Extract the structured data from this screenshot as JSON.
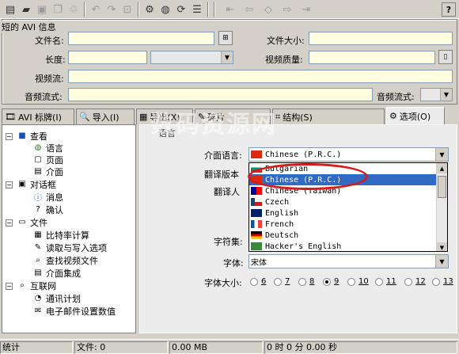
{
  "toolbar": {
    "icons": [
      "new-file-icon",
      "open-folder-icon",
      "save-icon",
      "copy-icon",
      "recycle-icon",
      "undo-icon",
      "redo-icon",
      "config-icon",
      "web-icon",
      "refresh-icon",
      "list-icon",
      "first-icon",
      "prev-icon",
      "diamond-icon",
      "next-icon",
      "last-icon"
    ],
    "help_label": "?"
  },
  "info_group": {
    "title": "短的 AVI 信息",
    "file_name_label": "文件名:",
    "file_name_value": "",
    "file_size_label": "文件大小:",
    "file_size_value": "",
    "length_label": "长度:",
    "length_value": "",
    "video_quality_label": "视频质量:",
    "video_quality_value": "",
    "video_stream_label": "视频流:",
    "video_stream_value": "",
    "audio_stream_label": "音频流式:",
    "audio_stream_value": "",
    "audio_stream2_label": "音频流式:",
    "audio_stream2_value": ""
  },
  "tabs": [
    {
      "label": "AVI 标牌(I)",
      "icon": "avi-icon"
    },
    {
      "label": "导入(I)",
      "icon": "search-icon"
    },
    {
      "label": "导出(X)",
      "icon": "table-icon"
    },
    {
      "label": "碎片",
      "icon": "puzzle-icon"
    },
    {
      "label": "结构(S)",
      "icon": "structure-icon"
    },
    {
      "label": "选项(O)",
      "icon": "options-icon"
    }
  ],
  "tree": {
    "items": [
      {
        "label": "查看",
        "icon": "view-icon",
        "level": 0
      },
      {
        "label": "语言",
        "icon": "globe-icon",
        "level": 1
      },
      {
        "label": "页面",
        "icon": "page-icon",
        "level": 1
      },
      {
        "label": "介面",
        "icon": "interface-icon",
        "level": 1
      },
      {
        "label": "对话框",
        "icon": "dialog-icon",
        "level": 0
      },
      {
        "label": "消息",
        "icon": "info-icon",
        "level": 1
      },
      {
        "label": "确认",
        "icon": "question-icon",
        "level": 1
      },
      {
        "label": "文件",
        "icon": "file-icon",
        "level": 0
      },
      {
        "label": "比特率计算",
        "icon": "calculator-icon",
        "level": 1
      },
      {
        "label": "读取与写入选项",
        "icon": "readwrite-icon",
        "level": 1
      },
      {
        "label": "查找视频文件",
        "icon": "find-icon",
        "level": 1
      },
      {
        "label": "介面集成",
        "icon": "integration-icon",
        "level": 1
      },
      {
        "label": "互联网",
        "icon": "internet-icon",
        "level": 0
      },
      {
        "label": "通讯计划",
        "icon": "schedule-icon",
        "level": 1
      },
      {
        "label": "电子邮件设置数值",
        "icon": "email-icon",
        "level": 1
      }
    ]
  },
  "options": {
    "section_fragment": "语言",
    "interface_language_label": "介面语言:",
    "interface_language_value": "Chinese (P.R.C.)",
    "translation_version_label": "翻译版本",
    "translator_label": "翻译人",
    "charset_label": "字符集:",
    "font_label": "字体:",
    "font_value": "宋体",
    "font_size_label": "字体大小:",
    "font_sizes": [
      "6",
      "7",
      "8",
      "9",
      "10",
      "11",
      "12",
      "13"
    ],
    "font_size_selected": "9",
    "language_list": [
      {
        "name": "Bulgarian",
        "flag": "bulgaria"
      },
      {
        "name": "Chinese (P.R.C.)",
        "flag": "china",
        "selected": true
      },
      {
        "name": "Chinese (Taiwan)",
        "flag": "taiwan"
      },
      {
        "name": "Czech",
        "flag": "czech"
      },
      {
        "name": "English",
        "flag": "uk"
      },
      {
        "name": "French",
        "flag": "france"
      },
      {
        "name": "Deutsch",
        "flag": "germany"
      },
      {
        "name": "Hacker's English",
        "flag": "hacker"
      }
    ]
  },
  "status": {
    "s1": "统计",
    "s2": "文件: 0",
    "s3": "0.00 MB",
    "s4": "0 时 0 分 0.00 秒"
  },
  "watermark": "数码资源网",
  "colors": {
    "field_bg": "#ffffe0",
    "selection": "#316ac5",
    "highlight_oval": "#d41c1c"
  }
}
